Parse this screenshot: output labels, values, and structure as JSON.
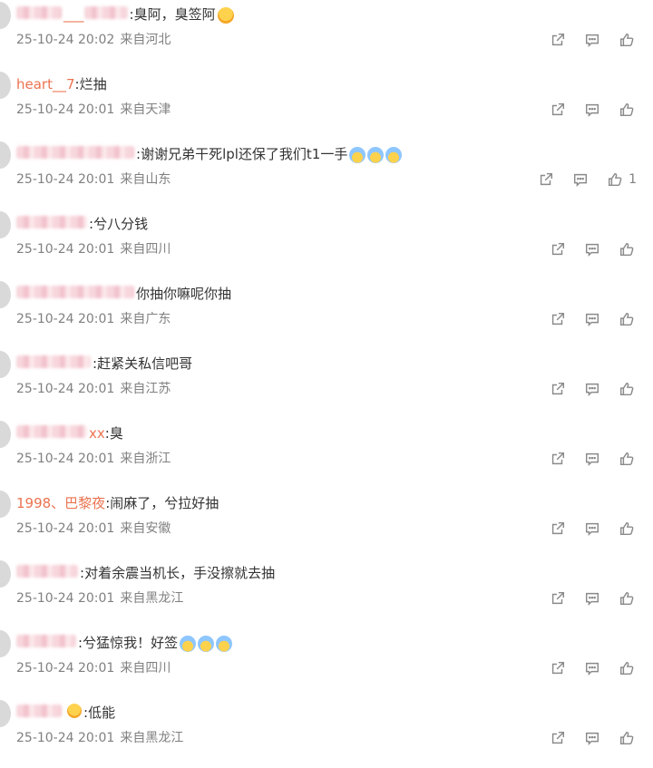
{
  "comments": [
    {
      "name_prefix": "",
      "name_suffix": "___",
      "text": "臭阿，臭签阿",
      "time": "25-10-24 20:02",
      "location": "来自河北",
      "likes": "",
      "emoji": 1,
      "emoji_style": "yellow",
      "blur_w": [
        50,
        48
      ]
    },
    {
      "name_prefix": "heart__7",
      "name_suffix": "",
      "text": "烂抽",
      "time": "25-10-24 20:01",
      "location": "来自天津",
      "likes": "",
      "emoji": 0,
      "emoji_style": "yellow",
      "blur_w": []
    },
    {
      "name_prefix": "",
      "name_suffix": "",
      "text": "谢谢兄弟干死lpl还保了我们t1一手",
      "time": "25-10-24 20:01",
      "location": "来自山东",
      "likes": "1",
      "emoji": 3,
      "emoji_style": "blue",
      "blur_w": [
        130
      ]
    },
    {
      "name_prefix": "",
      "name_suffix": "",
      "text": "兮八分钱",
      "time": "25-10-24 20:01",
      "location": "来自四川",
      "likes": "",
      "emoji": 0,
      "emoji_style": "yellow",
      "blur_w": [
        78
      ]
    },
    {
      "name_prefix": "",
      "name_suffix": "",
      "text": "你抽你嘛呢你抽",
      "time": "25-10-24 20:01",
      "location": "来自广东",
      "likes": "",
      "emoji": 0,
      "emoji_style": "yellow",
      "blur_w": [
        130
      ]
    },
    {
      "name_prefix": "",
      "name_suffix": "",
      "text": "赶紧关私信吧哥",
      "time": "25-10-24 20:01",
      "location": "来自江苏",
      "likes": "",
      "emoji": 0,
      "emoji_style": "yellow",
      "blur_w": [
        82
      ]
    },
    {
      "name_prefix": "",
      "name_suffix": "xx",
      "text": "臭",
      "time": "25-10-24 20:01",
      "location": "来自浙江",
      "likes": "",
      "emoji": 0,
      "emoji_style": "yellow",
      "blur_w": [
        78
      ]
    },
    {
      "name_prefix": "1998、巴黎夜",
      "name_suffix": "",
      "text": "闹麻了，兮拉好抽",
      "time": "25-10-24 20:01",
      "location": "来自安徽",
      "likes": "",
      "emoji": 0,
      "emoji_style": "yellow",
      "blur_w": []
    },
    {
      "name_prefix": "",
      "name_suffix": "",
      "text": "对着余震当机长，手没擦就去抽",
      "time": "25-10-24 20:01",
      "location": "来自黑龙江",
      "likes": "",
      "emoji": 0,
      "emoji_style": "yellow",
      "blur_w": [
        68
      ]
    },
    {
      "name_prefix": "",
      "name_suffix": "",
      "text": "兮猛惊我！好签",
      "time": "25-10-24 20:01",
      "location": "来自四川",
      "likes": "",
      "emoji": 3,
      "emoji_style": "blue",
      "blur_w": [
        66
      ]
    },
    {
      "name_prefix": "",
      "name_suffix": "",
      "text": "低能",
      "time": "25-10-24 20:01",
      "location": "来自黑龙江",
      "likes": "",
      "emoji": 0,
      "emoji_style": "yellow",
      "blur_w": [
        50
      ],
      "badge": true
    }
  ],
  "icons": {
    "share": "share-icon",
    "reply": "comment-icon",
    "like": "like-icon"
  },
  "colors": {
    "username": "#eb7350",
    "meta": "#808080",
    "text": "#333333"
  }
}
